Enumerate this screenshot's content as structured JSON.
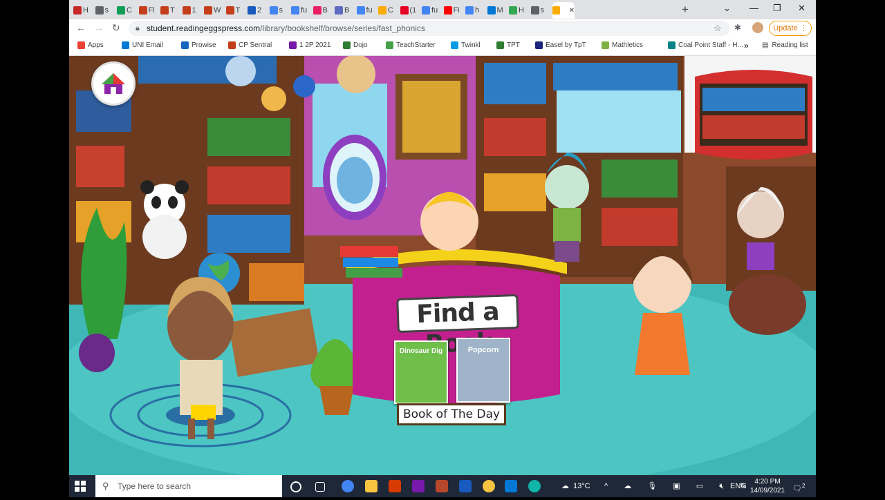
{
  "browser": {
    "tabs": [
      {
        "label": "H",
        "favicon": "news-icon",
        "color": "#c62828"
      },
      {
        "label": "s",
        "favicon": "globe-icon",
        "color": "#5f6368"
      },
      {
        "label": "C",
        "favicon": "classroom-icon",
        "color": "#0f9d58"
      },
      {
        "label": "Fl",
        "favicon": "powerpoint-icon",
        "color": "#c43e1c"
      },
      {
        "label": "T",
        "favicon": "powerpoint-icon",
        "color": "#c43e1c"
      },
      {
        "label": "1",
        "favicon": "powerpoint-icon",
        "color": "#c43e1c"
      },
      {
        "label": "W",
        "favicon": "powerpoint-icon",
        "color": "#c43e1c"
      },
      {
        "label": "T",
        "favicon": "powerpoint-icon",
        "color": "#c43e1c"
      },
      {
        "label": "2",
        "favicon": "word-icon",
        "color": "#185abd"
      },
      {
        "label": "s",
        "favicon": "google-icon",
        "color": "#4285f4"
      },
      {
        "label": "fu",
        "favicon": "google-icon",
        "color": "#4285f4"
      },
      {
        "label": "B",
        "favicon": "a-icon",
        "color": "#e91e63"
      },
      {
        "label": "B",
        "favicon": "b-icon",
        "color": "#5c6bc0"
      },
      {
        "label": "fu",
        "favicon": "google-icon",
        "color": "#4285f4"
      },
      {
        "label": "C",
        "favicon": "monitor-icon",
        "color": "#f9ab00"
      },
      {
        "label": "(1",
        "favicon": "pinterest-icon",
        "color": "#e60023"
      },
      {
        "label": "fu",
        "favicon": "google-icon",
        "color": "#4285f4"
      },
      {
        "label": "Fi",
        "favicon": "youtube-icon",
        "color": "#ff0000"
      },
      {
        "label": "h",
        "favicon": "google-icon",
        "color": "#4285f4"
      },
      {
        "label": "M",
        "favicon": "outlook-icon",
        "color": "#0078d4"
      },
      {
        "label": "H",
        "favicon": "checkbox-icon",
        "color": "#34a853"
      },
      {
        "label": "s",
        "favicon": "globe-icon",
        "color": "#5f6368"
      },
      {
        "label": "",
        "favicon": "reading-eggs-icon",
        "color": "#f9ab00",
        "active": true
      }
    ],
    "url_host": "student.readingeggspress.com",
    "url_path": "/library/bookshelf/browse/series/fast_phonics",
    "update_label": "Update",
    "bookmarks": [
      {
        "label": "Apps",
        "icon": "apps-grid-icon",
        "color": "#ea4335"
      },
      {
        "label": "UNI Email",
        "icon": "outlook-icon",
        "color": "#0078d4"
      },
      {
        "label": "Prowise",
        "icon": "prowise-icon",
        "color": "#1565c0"
      },
      {
        "label": "CP Sentral",
        "icon": "powerpoint-icon",
        "color": "#c43e1c"
      },
      {
        "label": "1 2P 2021",
        "icon": "onenote-icon",
        "color": "#7719aa"
      },
      {
        "label": "Dojo",
        "icon": "dojo-icon",
        "color": "#2e7d32"
      },
      {
        "label": "TeachStarter",
        "icon": "teachstarter-icon",
        "color": "#43a047"
      },
      {
        "label": "Twinkl",
        "icon": "twinkl-icon",
        "color": "#039be5"
      },
      {
        "label": "TPT",
        "icon": "tpt-icon",
        "color": "#2e7d32"
      },
      {
        "label": "Easel by TpT",
        "icon": "easel-icon",
        "color": "#1a237e"
      },
      {
        "label": "Mathletics",
        "icon": "mathletics-icon",
        "color": "#7cb342"
      },
      {
        "label": "Coal Point Staff - H...",
        "icon": "sharepoint-icon",
        "color": "#038387"
      }
    ],
    "reading_list_label": "Reading list"
  },
  "scene": {
    "find_a_book_label": "Find a Book",
    "book_of_the_day_label": "Book of The Day",
    "book1_title": "Dinosaur Dig",
    "book2_title": "Popcorn"
  },
  "taskbar": {
    "search_placeholder": "Type here to search",
    "weather": "13°C",
    "language": "ENG",
    "time": "4:20 PM",
    "date": "14/09/2021",
    "notification_count": "2"
  }
}
